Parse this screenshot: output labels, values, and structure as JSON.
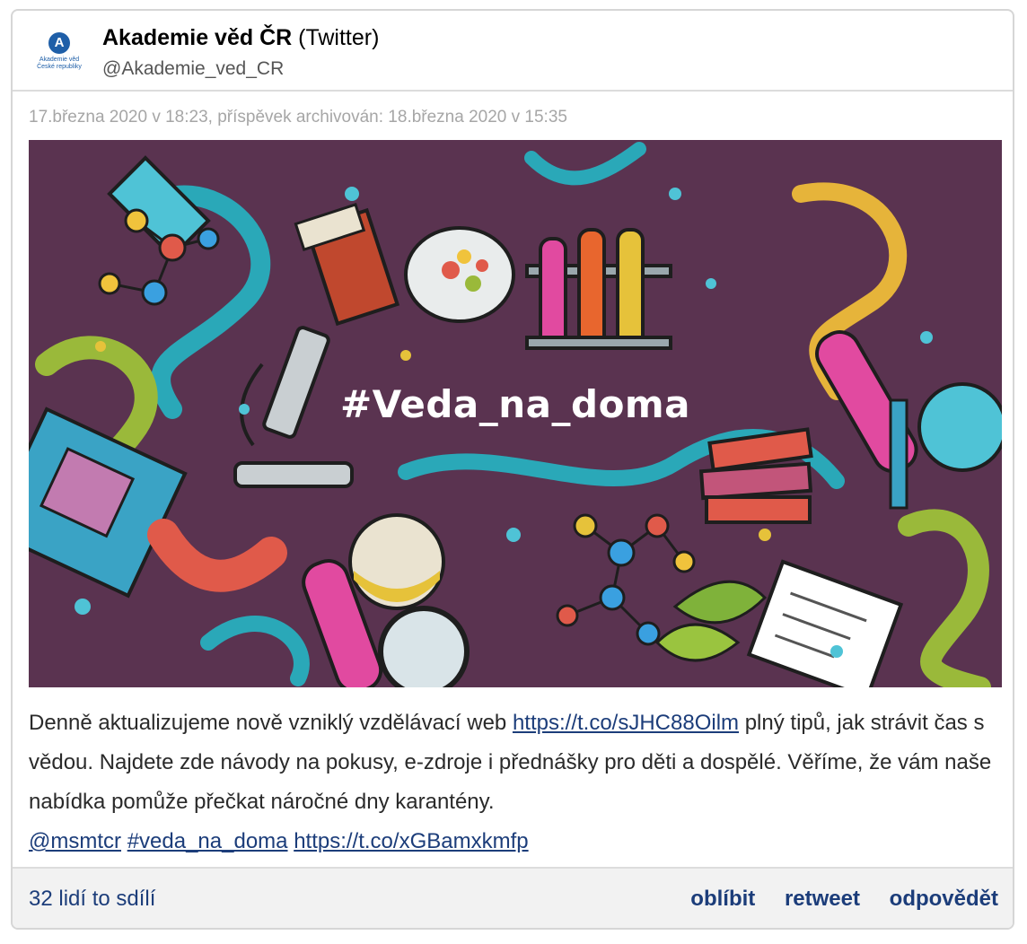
{
  "header": {
    "avatar_circle_letter": "A",
    "avatar_logo_line1": "Akademie věd",
    "avatar_logo_line2": "České republiky",
    "author_name": "Akademie věd ČR",
    "author_source": "(Twitter)",
    "handle": "@Akademie_ved_CR"
  },
  "meta": {
    "timestamp": "17.března 2020 v 18:23, příspěvek archivován: 18.března 2020 v 15:35"
  },
  "media": {
    "overlay_text": "#Veda_na_doma",
    "background_color": "#5a3350"
  },
  "post": {
    "text_part1": "Denně aktualizujeme nově vzniklý vzdělávací web ",
    "link1": "https://t.co/sJHC88Oilm",
    "text_part2": " plný tipů, jak strávit čas s vědou. Najdete zde návody na pokusy, e-zdroje i přednášky pro děti a dospělé. Věříme, že vám naše nabídka pomůže přečkat náročné dny karantény.",
    "mention": "@msmtcr",
    "hashtag": "#veda_na_doma",
    "link2": "https://t.co/xGBamxkmfp"
  },
  "footer": {
    "shares": "32 lidí to sdílí",
    "like_label": "oblíbit",
    "retweet_label": "retweet",
    "reply_label": "odpovědět"
  },
  "colors": {
    "link": "#1c3d7a",
    "meta_text": "#a6a6a6",
    "footer_bg": "#f2f2f2"
  }
}
